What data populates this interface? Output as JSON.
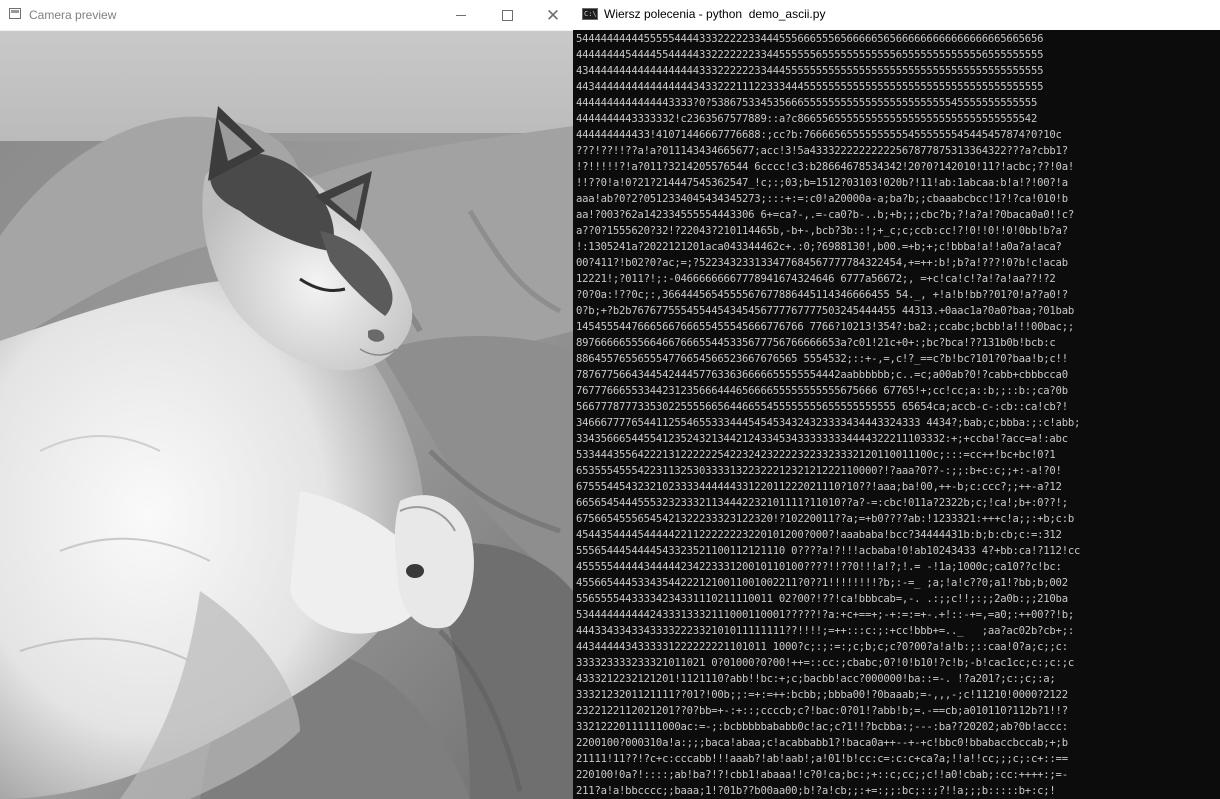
{
  "camera_window": {
    "title": "Camera preview",
    "controls": {
      "minimize": "minimize-icon",
      "maximize": "maximize-icon",
      "close": "close-icon"
    }
  },
  "console_window": {
    "title": "Wiersz polecenia - python  demo_ascii.py",
    "icon": "cmd-icon",
    "text_color": "#c8c8c8",
    "background": "#0c0c0c",
    "lines": [
      "5444444444455555444433322222334445556665556566666565666666666666666665665656",
      "4444444454444554444433222222233445555556555555555555655555555555556555555555",
      "4344444444444444444433322222233444555555555555555555555555555555555555555555",
      "4434444444444444444343322211122333444555555555555555555555555555555555555555",
      "4444444444444443333?0?53867533453566655555555555555555555555545555555555555",
      "4444444443333332!c2363567577889::a?c866556555555555555555555555555555555542",
      "444444444433!41071446667776688:;cc?b:766665655555555554555555545445457874?0?10c",
      "???!??!!??a!a?011143434665677;acc!3!5a43332222222222567877875313364322???a?cbb1?",
      "!?!!!!!?!a?011?3214205576544 6cccc!c3:b28664678534342!20?0?142010!11?!acbc;??!0a!",
      "!!??0!a!0?21?214447545362547_!c;:;03;b=1512?03103!020b?!11!ab:1abcaa:b!a!?!00?!a",
      "aaa!ab?0?2?0512334045434345273;:::+:=:c0!a20000a-a;ba?b;;cbaaabcbcc!1?!?ca!010!b",
      "aa!?003?62a142334555554443306 6+=ca?-,.=-ca0?b-..b;+b;;;cbc?b;?!a?a!?0baca0a0!!c?",
      "a??0?1555620?32!?22043?210114465b,-b+-,bcb?3b::!;+_c;c;ccb:cc!?!0!!0!!0!0bb!b?a?",
      "!:1305241a?2022121201aca043344462c+.:0;?6988130!,b00.=+b;+;c!bbba!a!!a0a?a!aca?",
      "00?411?!b02?0?ac;=;?522343233133477684567777784322454,+=++:b!;b?a!???!0?b!c!acab",
      "12221!;?011?!;:-04666666667778941674324646 6777a56672;, =+c!ca!c!?a!?a!aa??!?2",
      "?0?0a:!??0c;:,3664445654555567677886445114346666455 54._, +!a!b!bb??01?0!a??a0!?",
      "0?b;+?b2b7676775554554454345456777767777503245444455 44313.+0aac1a?0a0?baa;?01bab",
      "1454555447666566766655455545666776766 7766?10213!354?:ba2:;ccabc;bcbb!a!!!00bac;;",
      "8976666655566466766655445335677756766666653a?c01!21c+0+:;bc?bca!??131b0b!bcb:c",
      "886455765565554776654566523667676565 5554532;::+-,=,c!?_==c?b!bc?101?0?baa!b;c!!",
      "7876775664344542444577633636666655555554442aabbbbbb;c..=c;a00ab?0!?cabb+cbbbcca0",
      "7677766655334423123566644465666655555555555675666 67765!+;cc!cc;a::b;;::b:;ca?0b",
      "5667778777335302255556656446655455555555655555555555 65654ca;accb-c-:cb::ca!cb?!",
      "34666777765441125546553334445454534324323333434443324333 4434?;bab;c;bbba:;:c!abb;",
      "334356665445541235243213442124334534333333334444322211103332:+;+ccba!?acc=a!:abc",
      "5334443556422213122222254223242322223223323332120110011100c;:::=cc++!bc+bc!0?1",
      "6535554555422311325303333132232221232121222110000?!?aaa?0??-:;;:b+c:c;;+:-a!?0!",
      "6755544543232102333344444433122011222021110?10??!aaa;ba!00,++-b;c:ccc?;;++-a?12",
      "6656545444555323233321134442232101111?11010??a?-=:cbc!011a?2322b;c;!ca!;b+:0??!;",
      "67566545556545421322233323122320!?10220011??a;=+b0????ab:!1233321:+++c!a;;:+b;c:b",
      "4544354444544444221122222223220101200?000?!aaababa!bcc?34444431b:b;b:cb;c:=:312",
      "5556544454444543323521100112121110 0????a!?!!!acbaba!0!ab10243433 4?+bb:ca!?112!cc",
      "4555554444434444423422333120010110100????!!??0!!!a!?;!.= -!1a;1000c;ca10??c!bc:",
      "455665444533435442221210011001002211?0??1!!!!!!!!?b;:-=_ ;a;!a!c??0;a1!?bb;b;002",
      "55655554433334234331110211110011 02?00?!??!ca!bbbcab=,-. .:;;c!!;:;;2a0b:;;210ba",
      "5344444444442433313332111000110001?????!?a:+c+==+;-+:=:=+-.+!::-+=,=a0;:++00??!b;",
      "4443343343343333222332101011111111??!!!!;=++:::c:;:+cc!bbb+=.._   ;aa?ac02b?cb+;:",
      "4434444434333331222222221101011 1000?c;:;:=:;c;b;c;c?0?00?a!a!b:;::caa!0?a;c;;c:",
      "333323333233321011021 0?01000?0?00!++=::cc:;cbabc;0?!0!b10!?c!b;-b!cac1cc;c:;c:;c",
      "4333212232121201!1121110?abb!!bc:+;c;bacbb!acc?000000!ba::=-. !?a201?;c:;c;:a;",
      "3332123201121111??01?!00b;;:=+:=++:bcbb;;bbba00!?0baaab;=-,,,-;c!11210!0000?2122",
      "2322122112021201??0?bb=+-:+::;ccccb;c?!bac:0?01!?abb!b;=.-==cb;a010110?112b?1!!?",
      "33212220111111000ac:=-;:bcbbbbbababb0c!ac;c?1!!?bcbba:;---:ba??20202;ab?0b!accc:",
      "2200100?000310a!a:;;;baca!abaa;c!acabbabb1?!baca0a++--+-+c!bbc0!bbabaccbccab;+;b",
      "21111!11??!?c+c:cccabb!!!aaab?!ab!aab!;a!01!b!cc:c=:c:c+ca?a;!!a!!cc;;;c;:c+::==",
      "220100!0a?!::::;ab!ba?!?!cbb1!abaaa!!c?0!ca;bc:;+::c;cc;;c!!a0!cbab;:cc:++++:;=-",
      "211?a!a!bbcccc;;baaa;1!?01b??b00aa00;b!?a!cb;;:+=:;;:bc;::;?!!a;;;b:::::b+:c;!"
    ]
  }
}
